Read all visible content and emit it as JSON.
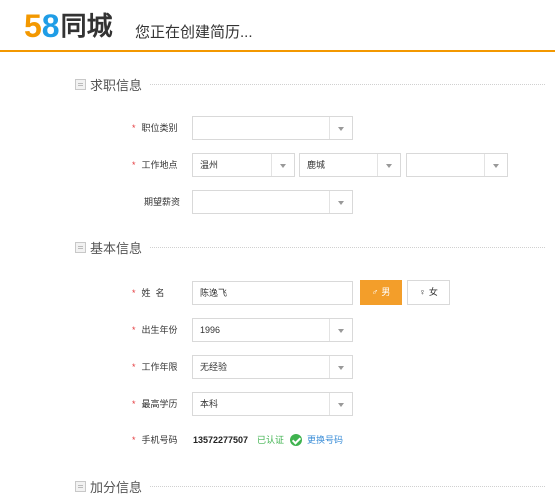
{
  "header": {
    "logo": {
      "digit_5": "5",
      "digit_8": "8",
      "brand": "同城"
    },
    "page_title": "您正在创建简历..."
  },
  "colors": {
    "accent_orange": "#f39800",
    "logo_blue": "#1f9de6",
    "required_star": "#e4393c",
    "verified_green": "#3fb34f",
    "link_blue": "#3d8fd8"
  },
  "sections": {
    "job": {
      "title": "求职信息",
      "icon": "document-icon"
    },
    "basic": {
      "title": "基本信息",
      "icon": "document-icon"
    },
    "bonus": {
      "title": "加分信息",
      "icon": "document-icon"
    }
  },
  "job_info": {
    "category": {
      "required_mark": "*",
      "label": "职位类别",
      "value": ""
    },
    "location": {
      "required_mark": "*",
      "label": "工作地点",
      "city": "温州",
      "district": "鹿城",
      "area": ""
    },
    "salary": {
      "label": "期望薪资",
      "value": ""
    }
  },
  "basic_info": {
    "name": {
      "required_mark": "*",
      "label": "姓  名",
      "value": "陈逸飞"
    },
    "gender": {
      "male_label": "男",
      "female_label": "女",
      "male_symbol": "♂",
      "female_symbol": "♀",
      "selected": "男"
    },
    "birth_year": {
      "required_mark": "*",
      "label": "出生年份",
      "value": "1996"
    },
    "work_years": {
      "required_mark": "*",
      "label": "工作年限",
      "value": "无经验"
    },
    "education": {
      "required_mark": "*",
      "label": "最高学历",
      "value": "本科"
    },
    "phone": {
      "required_mark": "*",
      "label": "手机号码",
      "value": "13572277507",
      "status": "已认证",
      "change_label": "更换号码"
    }
  }
}
